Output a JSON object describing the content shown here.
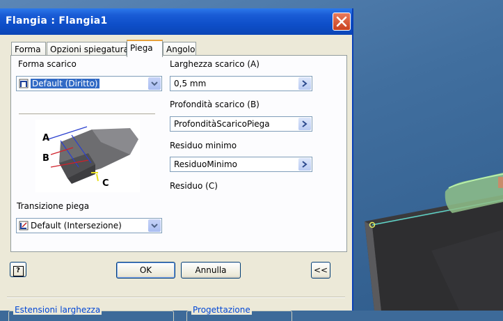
{
  "dialog": {
    "title": "Flangia : Flangia1",
    "tabs": [
      "Forma",
      "Opzioni spiegatura",
      "Piega",
      "Angolo"
    ],
    "active_tab": "Piega",
    "forma_scarico": {
      "label": "Forma scarico",
      "value": "Default (Diritto)"
    },
    "larghezza": {
      "label": "Larghezza scarico (A)",
      "value": "0,5 mm"
    },
    "profondita": {
      "label": "Profondità scarico (B)",
      "value": "ProfonditàScaricoPiega"
    },
    "residuo_minimo": {
      "label": "Residuo minimo",
      "value": "ResiduoMinimo"
    },
    "residuo_c": {
      "label": "Residuo (C)"
    },
    "preview_letters": {
      "a": "A",
      "b": "B",
      "c": "C"
    },
    "transizione": {
      "label": "Transizione piega",
      "value": "Default (Intersezione)"
    },
    "buttons": {
      "help": "?",
      "ok": "OK",
      "cancel": "Annulla",
      "collapse": "<<"
    },
    "groups": {
      "estensioni": "Estensioni larghezza",
      "progettazione": "Progettazione"
    }
  },
  "colors": {
    "title_bar": "#0b45b6",
    "dialog_bg": "#ece9d8",
    "viewport_bg": "#416f9f",
    "selection": "#316ac5",
    "model_highlight": "#7ee08a"
  }
}
